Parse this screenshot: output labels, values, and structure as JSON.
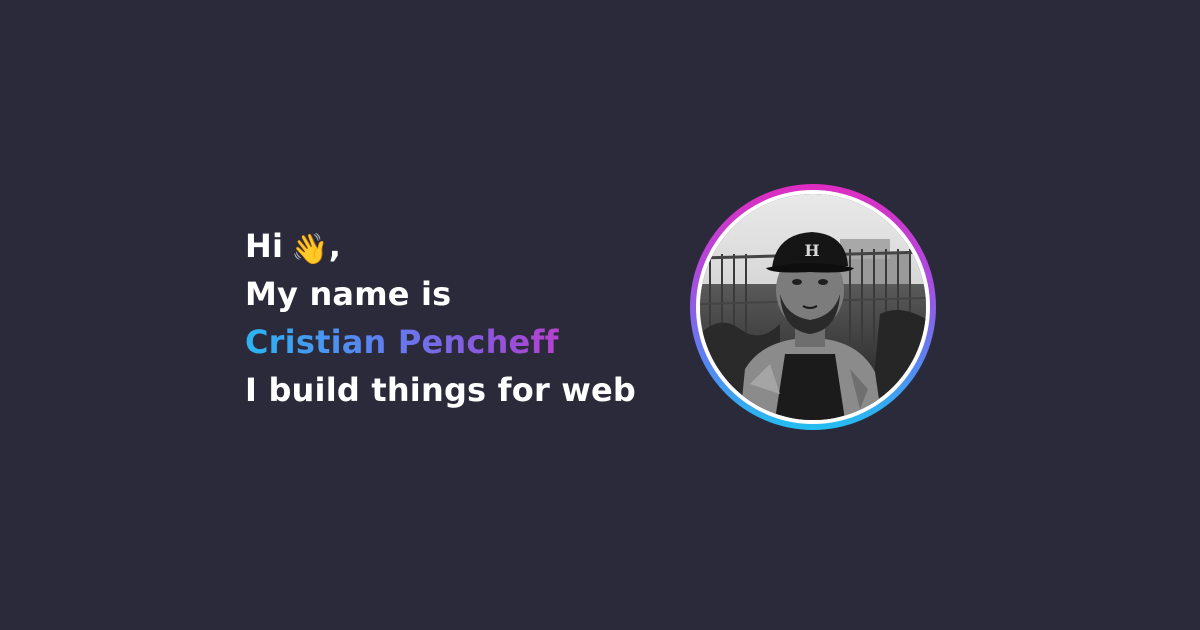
{
  "intro": {
    "greeting": "Hi",
    "wave_icon": "👋",
    "greeting_suffix": ",",
    "line_two": "My name is",
    "name": "Cristian Pencheff",
    "tagline": "I build things for web"
  },
  "avatar": {
    "icon": "profile-photo",
    "alt": "Cristian Pencheff"
  },
  "colors": {
    "background": "#2b2a3b",
    "text": "#ffffff",
    "gradient_start": "#2bb4f2",
    "gradient_mid": "#8c56dc",
    "gradient_end": "#e22cc1"
  }
}
